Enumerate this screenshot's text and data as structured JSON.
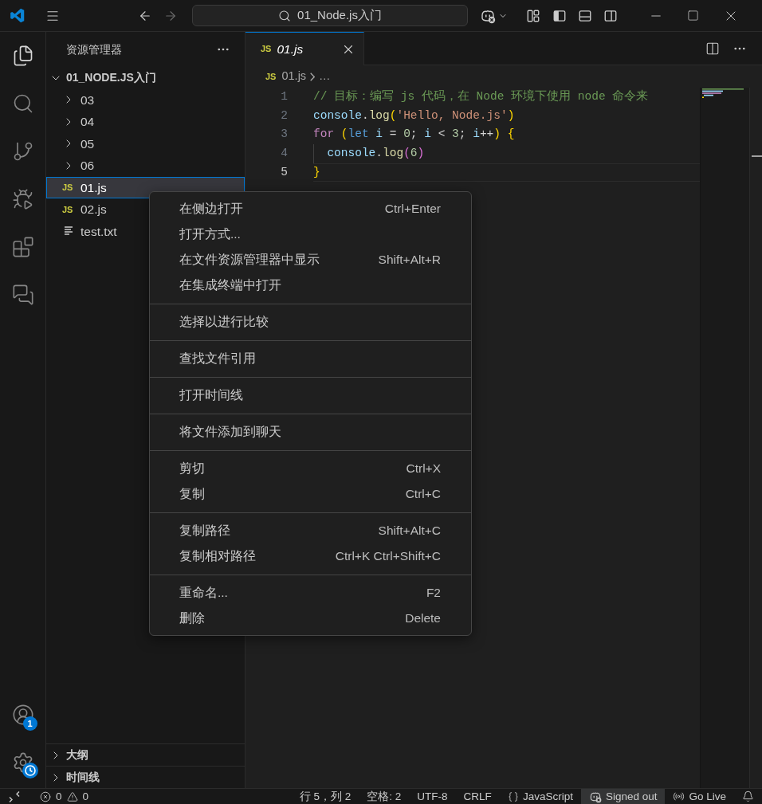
{
  "title_bar": {
    "nav": [
      {
        "kind": "back",
        "disabled": false
      },
      {
        "kind": "forward",
        "disabled": true
      }
    ],
    "command_center": "01_Node.js入门",
    "layout_toggles": [
      {
        "kind": "primary-sidebar",
        "on": true
      },
      {
        "kind": "panel",
        "on": false
      },
      {
        "kind": "secondary-sidebar",
        "on": false
      }
    ]
  },
  "activity_bar": {
    "items": [
      {
        "kind": "explorer",
        "selected": true
      },
      {
        "kind": "search",
        "selected": false
      },
      {
        "kind": "source-control",
        "selected": false
      },
      {
        "kind": "run-debug",
        "selected": false
      },
      {
        "kind": "extensions",
        "selected": false
      },
      {
        "kind": "chat",
        "selected": false
      }
    ],
    "accounts_badge": "1"
  },
  "explorer": {
    "title": "资源管理器",
    "root": {
      "name": "01_NODE.JS入门",
      "expanded": true,
      "selected": false,
      "children": [
        {
          "kind": "folder",
          "name": "03",
          "expanded": false,
          "selected": false
        },
        {
          "kind": "folder",
          "name": "04",
          "expanded": false,
          "selected": false
        },
        {
          "kind": "folder",
          "name": "05",
          "expanded": false,
          "selected": false
        },
        {
          "kind": "folder",
          "name": "06",
          "expanded": false,
          "selected": false
        },
        {
          "kind": "js",
          "icon": "JS",
          "name": "01.js",
          "selected": true
        },
        {
          "kind": "js",
          "icon": "JS",
          "name": "02.js",
          "selected": false
        },
        {
          "kind": "text",
          "name": "test.txt",
          "selected": false
        }
      ]
    },
    "sections": [
      {
        "title": "大纲",
        "expanded": false
      },
      {
        "title": "时间线",
        "expanded": false
      }
    ]
  },
  "editor": {
    "tabs": [
      {
        "icon": "JS",
        "label": "01.js",
        "selected": true,
        "preview": true
      }
    ],
    "breadcrumb": [
      {
        "kind": "file",
        "icon": "JS",
        "label": "01.js"
      },
      {
        "kind": "more",
        "label": "…"
      }
    ],
    "lines": [
      {
        "number": "1",
        "current": false,
        "indent_guide": false,
        "tokens": [
          {
            "kind": "comment",
            "text": "// 目标：编写 js 代码，在 Node 环境下使用 node 命令来"
          }
        ]
      },
      {
        "number": "2",
        "current": false,
        "indent_guide": false,
        "tokens": [
          {
            "kind": "variable",
            "text": "console"
          },
          {
            "kind": "plain",
            "text": "."
          },
          {
            "kind": "function",
            "text": "log"
          },
          {
            "kind": "bracket-1",
            "text": "("
          },
          {
            "kind": "string",
            "text": "'Hello, Node.js'"
          },
          {
            "kind": "bracket-1",
            "text": ")"
          }
        ]
      },
      {
        "number": "3",
        "current": false,
        "indent_guide": false,
        "tokens": [
          {
            "kind": "control",
            "text": "for "
          },
          {
            "kind": "bracket-1",
            "text": "("
          },
          {
            "kind": "keyword",
            "text": "let "
          },
          {
            "kind": "variable",
            "text": "i"
          },
          {
            "kind": "plain",
            "text": " = "
          },
          {
            "kind": "number",
            "text": "0"
          },
          {
            "kind": "plain",
            "text": "; "
          },
          {
            "kind": "variable",
            "text": "i"
          },
          {
            "kind": "plain",
            "text": " < "
          },
          {
            "kind": "number",
            "text": "3"
          },
          {
            "kind": "plain",
            "text": "; "
          },
          {
            "kind": "variable",
            "text": "i"
          },
          {
            "kind": "plain",
            "text": "++"
          },
          {
            "kind": "bracket-1",
            "text": ") {"
          }
        ]
      },
      {
        "number": "4",
        "current": false,
        "indent_guide": true,
        "tokens": [
          {
            "kind": "variable",
            "text": "console"
          },
          {
            "kind": "plain",
            "text": "."
          },
          {
            "kind": "function",
            "text": "log"
          },
          {
            "kind": "bracket-2",
            "text": "("
          },
          {
            "kind": "number",
            "text": "6"
          },
          {
            "kind": "bracket-2",
            "text": ")"
          }
        ]
      },
      {
        "number": "5",
        "current": true,
        "indent_guide": false,
        "tokens": [
          {
            "kind": "bracket-1",
            "text": "}"
          }
        ]
      }
    ]
  },
  "context_menu": {
    "groups": [
      {
        "items": [
          {
            "label": "在侧边打开",
            "shortcut": "Ctrl+Enter"
          },
          {
            "label": "打开方式..."
          },
          {
            "label": "在文件资源管理器中显示",
            "shortcut": "Shift+Alt+R"
          },
          {
            "label": "在集成终端中打开"
          }
        ]
      },
      {
        "items": [
          {
            "label": "选择以进行比较"
          }
        ]
      },
      {
        "items": [
          {
            "label": "查找文件引用"
          }
        ]
      },
      {
        "items": [
          {
            "label": "打开时间线"
          }
        ]
      },
      {
        "items": [
          {
            "label": "将文件添加到聊天"
          }
        ]
      },
      {
        "items": [
          {
            "label": "剪切",
            "shortcut": "Ctrl+X"
          },
          {
            "label": "复制",
            "shortcut": "Ctrl+C"
          }
        ]
      },
      {
        "items": [
          {
            "label": "复制路径",
            "shortcut": "Shift+Alt+C"
          },
          {
            "label": "复制相对路径",
            "shortcut": "Ctrl+K Ctrl+Shift+C"
          }
        ]
      },
      {
        "items": [
          {
            "label": "重命名...",
            "shortcut": "F2"
          },
          {
            "label": "删除",
            "shortcut": "Delete"
          }
        ]
      }
    ]
  },
  "status_bar": {
    "errors": "0",
    "warnings": "0",
    "items": [
      {
        "kind": "text",
        "label": "行 5，列 2"
      },
      {
        "kind": "text",
        "label": "空格: 2"
      },
      {
        "kind": "text",
        "label": "UTF-8"
      },
      {
        "kind": "text",
        "label": "CRLF"
      },
      {
        "kind": "language",
        "label": "JavaScript"
      },
      {
        "kind": "account",
        "label": "Signed out"
      },
      {
        "kind": "live",
        "label": "Go Live"
      },
      {
        "kind": "notifications"
      }
    ]
  }
}
